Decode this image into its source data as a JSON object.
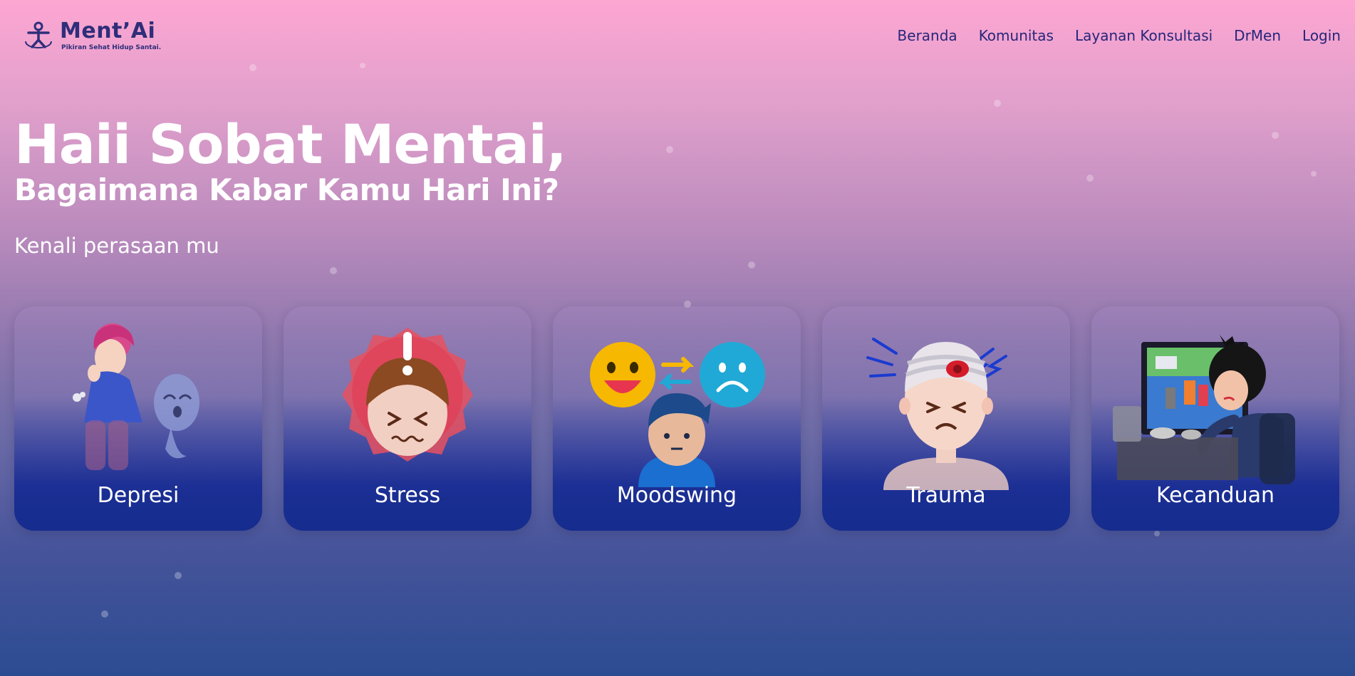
{
  "brand": {
    "name": "Ment’Ai",
    "tagline": "Pikiran Sehat Hidup Santai."
  },
  "nav": {
    "items": [
      {
        "label": "Beranda"
      },
      {
        "label": "Komunitas"
      },
      {
        "label": "Layanan Konsultasi"
      },
      {
        "label": "DrMen"
      },
      {
        "label": "Login"
      }
    ]
  },
  "hero": {
    "title": "Haii Sobat Mentai,",
    "subtitle": "Bagaimana Kabar Kamu Hari Ini?",
    "lead": "Kenali perasaan mu"
  },
  "categories": [
    {
      "label": "Depresi",
      "icon": "sad-person-illustration"
    },
    {
      "label": "Stress",
      "icon": "stressed-face-illustration"
    },
    {
      "label": "Moodswing",
      "icon": "happy-sad-emoji-illustration"
    },
    {
      "label": "Trauma",
      "icon": "injured-head-illustration"
    },
    {
      "label": "Kecanduan",
      "icon": "gaming-addict-illustration"
    }
  ],
  "colors": {
    "nav_text": "#26267a",
    "brand_text": "#2e2e7a",
    "hero_text": "#ffffff",
    "card_bottom": "#152c8e",
    "gradient_top": "#fda6d2",
    "gradient_bottom": "#2c4c92"
  }
}
